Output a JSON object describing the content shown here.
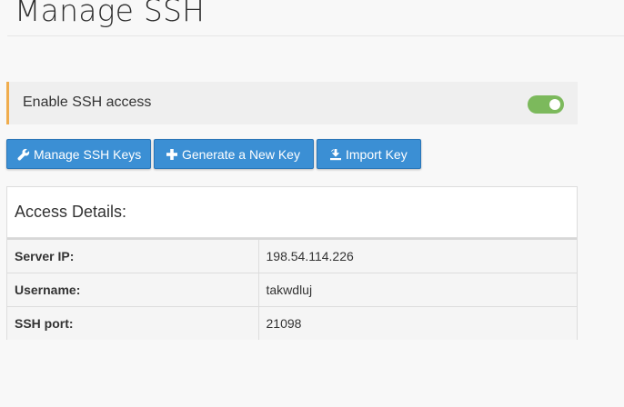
{
  "page": {
    "title": "Manage SSH"
  },
  "ssh_toggle": {
    "label": "Enable SSH access",
    "enabled": true,
    "accent_color": "#f0ad4e",
    "on_color": "#7cb95c"
  },
  "toolbar": {
    "manage_keys": {
      "label": "Manage SSH Keys",
      "icon": "wrench-icon"
    },
    "generate_key": {
      "label": "Generate a New Key",
      "icon": "plus-icon"
    },
    "import_key": {
      "label": "Import Key",
      "icon": "import-icon"
    },
    "button_color": "#3b8fd4"
  },
  "access_details": {
    "heading": "Access Details:",
    "rows": [
      {
        "label": "Server IP:",
        "value": "198.54.114.226"
      },
      {
        "label": "Username:",
        "value": "takwdluj"
      },
      {
        "label": "SSH port:",
        "value": "21098"
      }
    ]
  }
}
